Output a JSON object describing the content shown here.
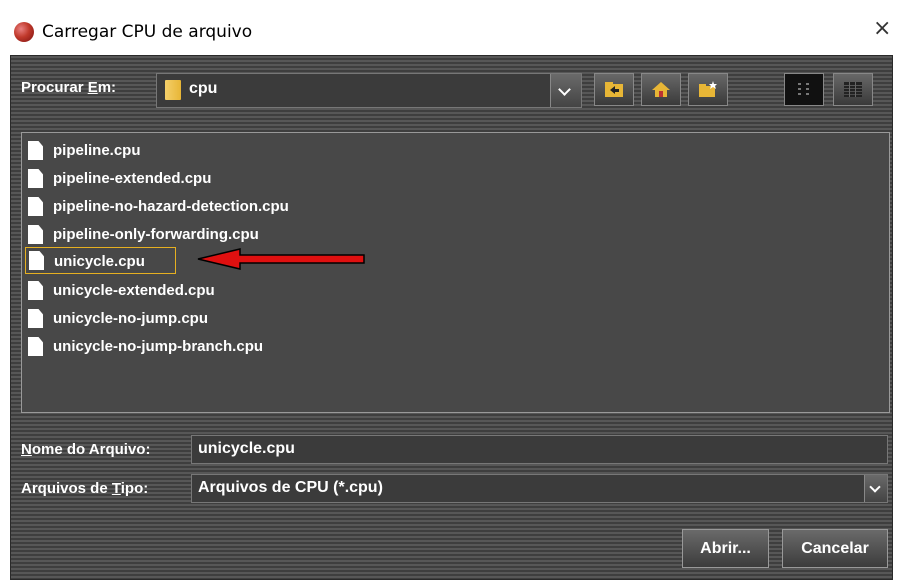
{
  "window": {
    "title": "Carregar CPU de arquivo",
    "close_glyph": "×"
  },
  "lookin": {
    "label_pre": "Procurar ",
    "label_mnemonic": "E",
    "label_post": "m:",
    "value": "cpu"
  },
  "toolbar": {
    "icons": [
      "up-folder-icon",
      "home-icon",
      "new-folder-icon",
      "list-view-icon",
      "details-view-icon"
    ]
  },
  "files": [
    {
      "name": "pipeline.cpu",
      "selected": false
    },
    {
      "name": "pipeline-extended.cpu",
      "selected": false
    },
    {
      "name": "pipeline-no-hazard-detection.cpu",
      "selected": false
    },
    {
      "name": "pipeline-only-forwarding.cpu",
      "selected": false
    },
    {
      "name": "unicycle.cpu",
      "selected": true
    },
    {
      "name": "unicycle-extended.cpu",
      "selected": false
    },
    {
      "name": "unicycle-no-jump.cpu",
      "selected": false
    },
    {
      "name": "unicycle-no-jump-branch.cpu",
      "selected": false
    }
  ],
  "filename": {
    "label_mnemonic": "N",
    "label_post": "ome do Arquivo:",
    "value": "unicycle.cpu"
  },
  "filetype": {
    "label_pre": "Arquivos de ",
    "label_mnemonic": "T",
    "label_post": "ipo:",
    "value": "Arquivos de CPU (*.cpu)"
  },
  "buttons": {
    "open": "Abrir...",
    "cancel": "Cancelar"
  },
  "colors": {
    "panel": "#4a4a4a",
    "selection_border": "#e6b021",
    "arrow": "#e01010"
  }
}
